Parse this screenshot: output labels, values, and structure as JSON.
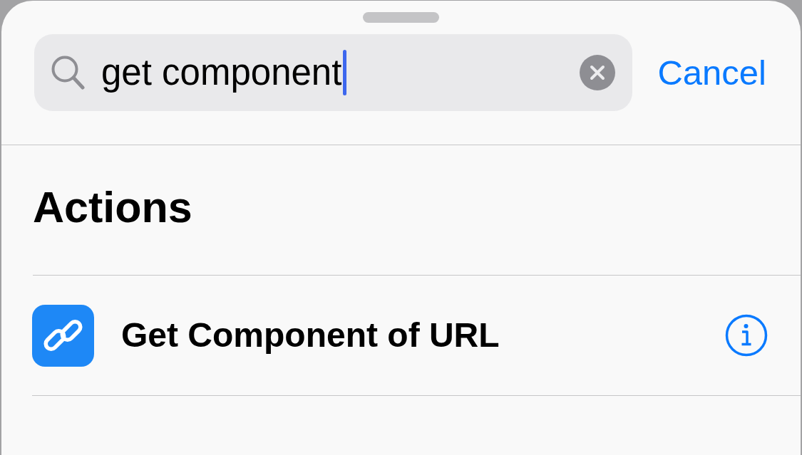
{
  "search": {
    "value": "get component",
    "focused": true,
    "cancel_label": "Cancel"
  },
  "sections": [
    {
      "title": "Actions",
      "items": [
        {
          "label": "Get Component of URL"
        }
      ]
    }
  ]
}
